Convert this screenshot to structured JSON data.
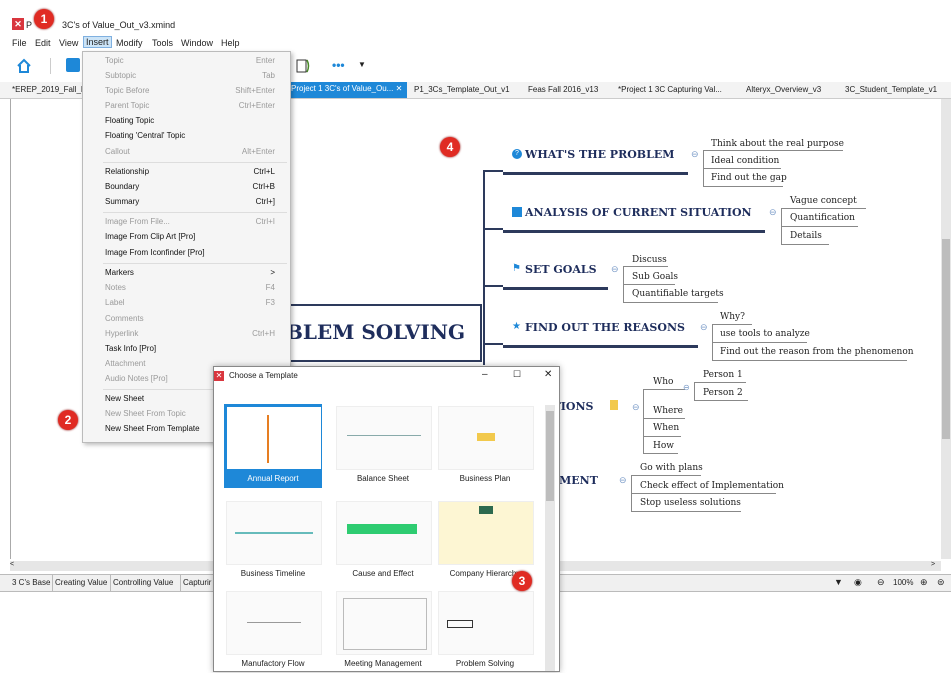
{
  "window": {
    "title": "Project 1 3C's of Value_Out_v3.xmind",
    "title_visible": "3C's of Value_Out_v3.xmind"
  },
  "menubar": [
    "File",
    "Edit",
    "View",
    "Insert",
    "Modify",
    "Tools",
    "Window",
    "Help"
  ],
  "tabs": [
    "*EREP_2019_Fall_P",
    "Project 1 3C's of Value_Ou...",
    "P1_3Cs_Template_Out_v1",
    "Feas Fall 2016_v13",
    "*Project 1 3C Capturing Val...",
    "Alteryx_Overview_v3",
    "3C_Student_Template_v1"
  ],
  "insert_menu": {
    "items": [
      {
        "label": "Topic",
        "shortcut": "Enter",
        "disabled": true
      },
      {
        "label": "Subtopic",
        "shortcut": "Tab",
        "disabled": true
      },
      {
        "label": "Topic Before",
        "shortcut": "Shift+Enter",
        "disabled": true
      },
      {
        "label": "Parent Topic",
        "shortcut": "Ctrl+Enter",
        "disabled": true
      },
      {
        "label": "Floating Topic",
        "shortcut": "",
        "disabled": false
      },
      {
        "label": "Floating 'Central' Topic",
        "shortcut": "",
        "disabled": false
      },
      {
        "label": "Callout",
        "shortcut": "Alt+Enter",
        "disabled": true
      },
      {
        "label": "Relationship",
        "shortcut": "Ctrl+L",
        "disabled": false
      },
      {
        "label": "Boundary",
        "shortcut": "Ctrl+B",
        "disabled": false
      },
      {
        "label": "Summary",
        "shortcut": "Ctrl+]",
        "disabled": false
      },
      {
        "label": "Image From File...",
        "shortcut": "Ctrl+I",
        "disabled": true
      },
      {
        "label": "Image From Clip Art [Pro]",
        "shortcut": "",
        "disabled": false
      },
      {
        "label": "Image From Iconfinder [Pro]",
        "shortcut": "",
        "disabled": false
      },
      {
        "label": "Markers",
        "shortcut": ">",
        "disabled": false
      },
      {
        "label": "Notes",
        "shortcut": "F4",
        "disabled": true
      },
      {
        "label": "Label",
        "shortcut": "F3",
        "disabled": true
      },
      {
        "label": "Comments",
        "shortcut": "",
        "disabled": true
      },
      {
        "label": "Hyperlink",
        "shortcut": "Ctrl+H",
        "disabled": true
      },
      {
        "label": "Task Info [Pro]",
        "shortcut": "",
        "disabled": false
      },
      {
        "label": "Attachment",
        "shortcut": "",
        "disabled": true
      },
      {
        "label": "Audio Notes [Pro]",
        "shortcut": "",
        "disabled": true
      },
      {
        "label": "New Sheet",
        "shortcut": "",
        "disabled": false
      },
      {
        "label": "New Sheet From Topic",
        "shortcut": "",
        "disabled": true
      },
      {
        "label": "New Sheet From Template",
        "shortcut": "",
        "disabled": false
      }
    ]
  },
  "template_dialog": {
    "title": "Choose a Template",
    "templates": [
      "Annual Report",
      "Balance Sheet",
      "Business Plan",
      "Business Timeline",
      "Cause and Effect",
      "Company Hierarchy",
      "Manufactory Flow",
      "Meeting Management",
      "Problem Solving"
    ]
  },
  "mindmap": {
    "central": "BLEM SOLVING",
    "branches": [
      {
        "title": "WHAT'S THE PROBLEM",
        "children": [
          "Think about the real purpose",
          "Ideal condition",
          "Find out the gap"
        ]
      },
      {
        "title": "ANALYSIS OF CURRENT SITUATION",
        "children": [
          "Vague concept",
          "Quantification",
          "Details"
        ]
      },
      {
        "title": "SET GOALS",
        "children": [
          "Discuss",
          "Sub Goals",
          "Quantifiable targets"
        ]
      },
      {
        "title": "FIND OUT THE REASONS",
        "children": [
          "Why?",
          "use tools to analyze",
          "Find out the reason from the phenomenon"
        ]
      },
      {
        "title": "UTIONS",
        "children": [
          "Who",
          "Where",
          "When",
          "How"
        ],
        "grandchildren": [
          "Person 1",
          "Person 2"
        ]
      },
      {
        "title": "LEMENT",
        "children": [
          "Go with plans",
          "Check effect of Implementation",
          "Stop useless solutions"
        ]
      }
    ]
  },
  "sheets": [
    "3 C's Base",
    "Creating Value",
    "Controlling Value",
    "Capturir"
  ],
  "status": {
    "zoom": "100%"
  },
  "badges": [
    "1",
    "2",
    "3",
    "4"
  ]
}
